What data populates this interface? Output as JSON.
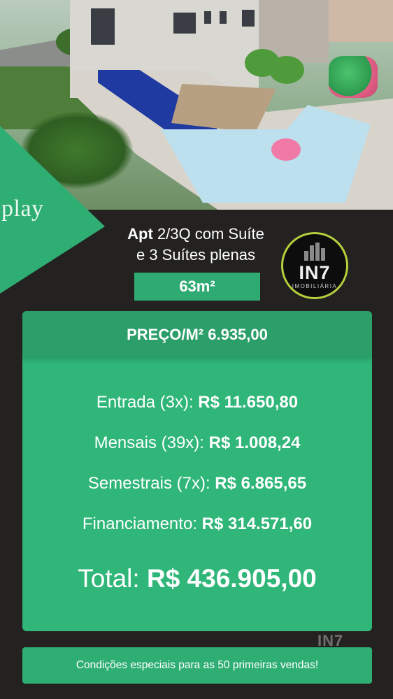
{
  "brand": {
    "name": "play",
    "agency_word": "IN7",
    "agency_sub": "IMOBILIÁRIA"
  },
  "headline": {
    "line1_bold": "Apt",
    "line1_rest": "2/3Q com Suíte",
    "line2": "e 3 Suítes plenas"
  },
  "area": "63m²",
  "price_card": {
    "header": "PREÇO/M² 6.935,00",
    "rows": [
      {
        "label": "Entrada (3x):",
        "value": "R$ 11.650,80"
      },
      {
        "label": "Mensais (39x):",
        "value": "R$ 1.008,24"
      },
      {
        "label": "Semestrais (7x):",
        "value": "R$ 6.865,65"
      },
      {
        "label": "Financiamento:",
        "value": "R$ 314.571,60"
      }
    ],
    "total": {
      "label": "Total:",
      "value": "R$ 436.905,00"
    }
  },
  "footer": "Condições especiais para as 50 primeiras vendas!",
  "colors": {
    "background": "#232220",
    "green": "#2fb678",
    "green_dark": "#2c9e69",
    "logo_ring": "#b6cf3c"
  }
}
